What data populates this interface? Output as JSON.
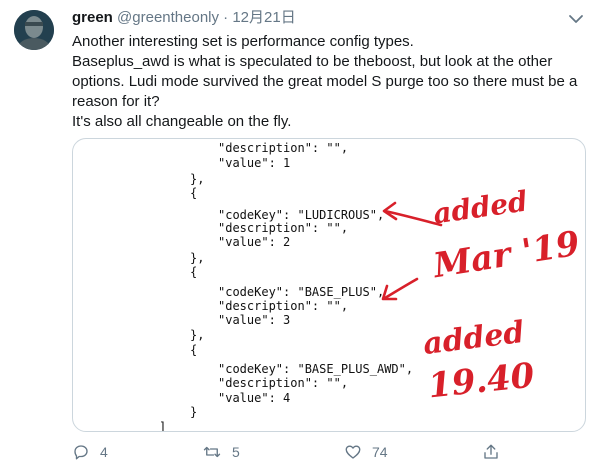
{
  "tweet": {
    "name": "green",
    "handle": "@greentheonly",
    "separator": "·",
    "date": "12月21日",
    "text_lines": [
      "Another interesting set is performance config types.",
      "Baseplus_awd is what is speculated to be theboost, but look at the other",
      "options. Ludi mode survived the great model S purge too so there must be a",
      "reason for it?",
      "It's also all changeable on the fly."
    ]
  },
  "code_lines": [
    "\"description\": \"\",",
    "\"value\": 1",
    "},",
    "{",
    "\"codeKey\": \"LUDICROUS\",",
    "\"description\": \"\",",
    "\"value\": 2",
    "},",
    "{",
    "\"codeKey\": \"BASE_PLUS\",",
    "\"description\": \"\",",
    "\"value\": 3",
    "},",
    "{",
    "\"codeKey\": \"BASE_PLUS_AWD\",",
    "\"description\": \"\",",
    "\"value\": 4",
    "}",
    "]"
  ],
  "annotations": {
    "note1_line1": "added",
    "note1_line2": "Mar '19",
    "note2_line1": "added",
    "note2_line2": "19.40"
  },
  "actions": {
    "reply_count": "4",
    "retweet_count": "5",
    "like_count": "74"
  },
  "colors": {
    "annotation": "#d8202a",
    "meta_gray": "#657786",
    "avatar_bg": "#1f3a4c"
  },
  "icons": [
    "avatar",
    "chevron-down-icon",
    "reply-icon",
    "retweet-icon",
    "like-icon",
    "share-icon",
    "arrow-icon"
  ]
}
